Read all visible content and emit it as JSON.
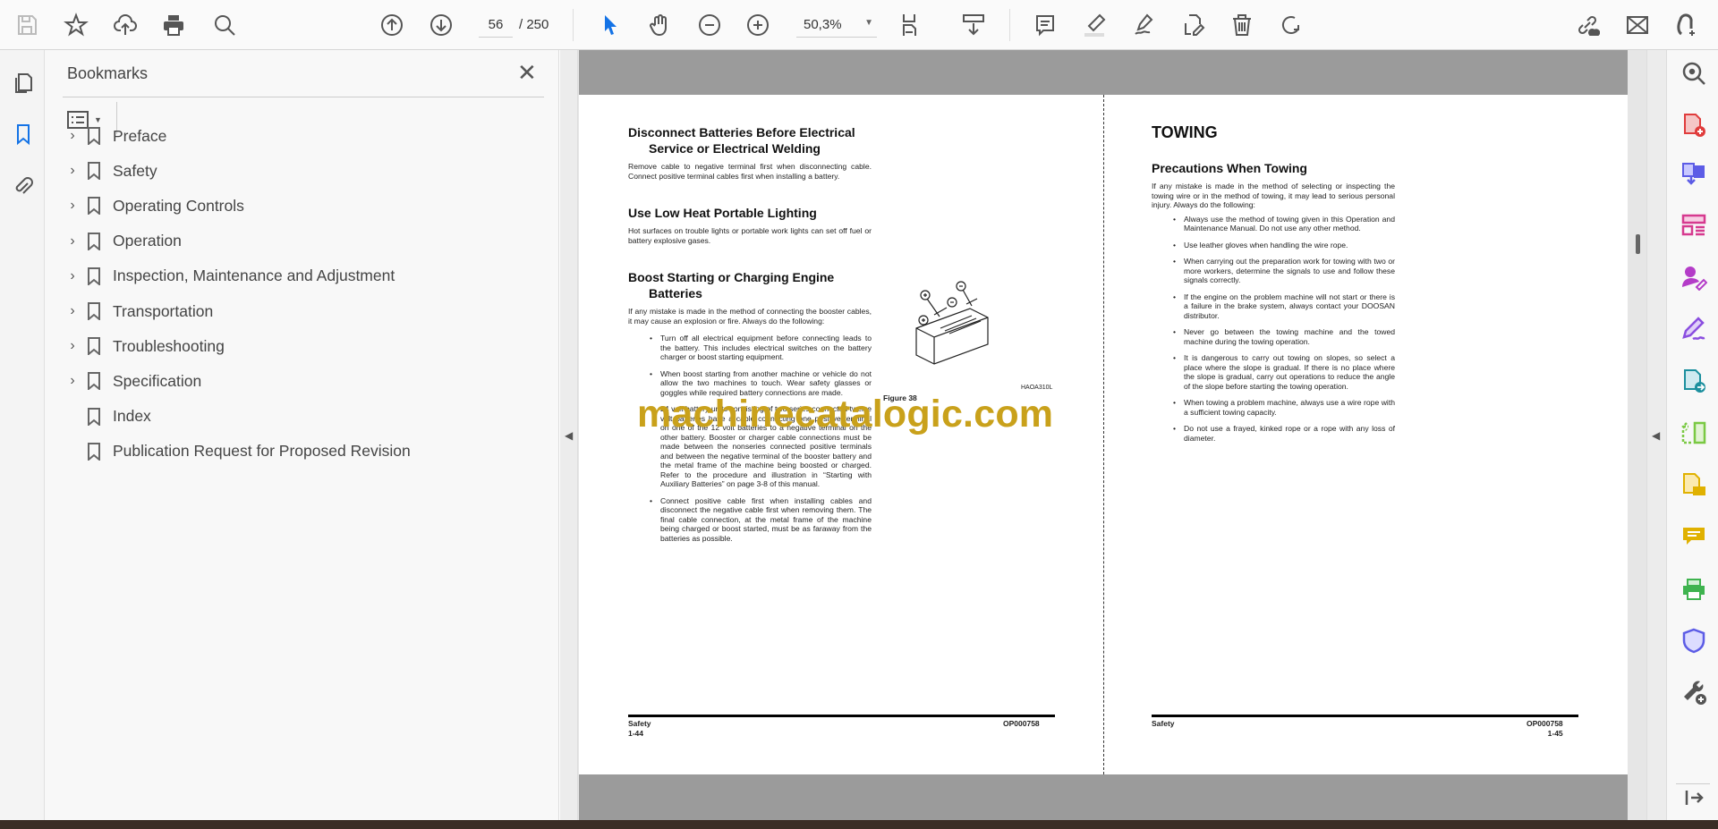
{
  "toolbar": {
    "page_current": "56",
    "page_total": "/ 250",
    "zoom": "50,3%",
    "tools": [
      "save-icon",
      "bookmark-star-icon",
      "upload-cloud-icon",
      "print-icon",
      "find-icon",
      "page-up-icon",
      "page-down-icon",
      "select-cursor-icon",
      "hand-icon",
      "zoom-out-icon",
      "zoom-in-icon",
      "fit-page-icon",
      "scroll-mode-icon",
      "comment-icon",
      "highlight-icon",
      "sign-icon",
      "edit-pdf-icon",
      "delete-icon",
      "rotate-icon",
      "share-link-icon",
      "email-icon",
      "add-user-icon"
    ]
  },
  "bookmarks": {
    "title": "Bookmarks",
    "items": [
      {
        "label": "Preface",
        "expandable": true
      },
      {
        "label": "Safety",
        "expandable": true
      },
      {
        "label": "Operating Controls",
        "expandable": true
      },
      {
        "label": "Operation",
        "expandable": true
      },
      {
        "label": "Inspection, Maintenance and Adjustment",
        "expandable": true
      },
      {
        "label": "Transportation",
        "expandable": true
      },
      {
        "label": "Troubleshooting",
        "expandable": true
      },
      {
        "label": "Specification",
        "expandable": true
      },
      {
        "label": "Index",
        "expandable": false
      },
      {
        "label": "Publication Request for Proposed Revision",
        "expandable": false
      }
    ]
  },
  "left_page": {
    "h1a": "Disconnect Batteries Before Electrical",
    "h1b": "Service or Electrical Welding",
    "p1": "Remove cable to negative terminal first when disconnecting cable. Connect positive terminal cables first when installing a battery.",
    "h2": "Use Low Heat Portable Lighting",
    "p2": "Hot surfaces on trouble lights or portable work lights can set off fuel or battery explosive gases.",
    "h3a": "Boost Starting or Charging Engine",
    "h3b": "Batteries",
    "p3": "If any mistake is made in the method of connecting the booster cables, it may cause an explosion or fire. Always do the following:",
    "bullets": [
      "Turn off all electrical equipment before connecting leads to the battery. This includes electrical switches on the battery charger or boost starting equipment.",
      "When boost starting from another machine or vehicle do not allow the two machines to touch. Wear safety glasses or goggles while required battery connections are made.",
      "24 volt battery units consisting of two series connected twelve volt batteries have a cable connecting one positive terminal on one of the 12 volt batteries to a negative terminal on the other battery. Booster or charger cable connections must be made between the nonseries connected positive terminals and between the negative terminal of the booster battery and the metal frame of the machine being boosted or charged. Refer to the procedure and illustration in “Starting with Auxiliary Batteries” on page 3-8 of this manual.",
      "Connect positive cable first when installing cables and disconnect the negative cable first when removing them. The final cable connection, at the metal frame of the machine being charged or boost started, must be as faraway from the batteries as possible."
    ],
    "figure_code": "HAOA310L",
    "figure_caption": "Figure 38",
    "footer_section": "Safety",
    "footer_page": "1-44",
    "footer_code": "OP000758"
  },
  "right_page": {
    "title": "TOWING",
    "h1": "Precautions When Towing",
    "p1": "If any mistake is made in the method of selecting or inspecting the towing wire or in the method of towing, it may lead to serious personal injury. Always do the following:",
    "bullets": [
      "Always use the method of towing given in this Operation and Maintenance Manual. Do not use any other method.",
      "Use leather gloves when handling the wire rope.",
      "When carrying out the preparation work for towing with two or more workers, determine the signals to use and follow these signals correctly.",
      "If the engine on the problem machine will not start or there is a failure in the brake system, always contact your DOOSAN distributor.",
      "Never go between the towing machine and the towed machine during the towing operation.",
      "It is dangerous to carry out towing on slopes, so select a place where the slope is gradual. If there is no place where the slope is gradual, carry out operations to reduce the angle of the slope before starting the towing operation.",
      "When towing a problem machine, always use a wire rope with a sufficient towing capacity.",
      "Do not use a frayed, kinked rope or a rope with any loss of diameter."
    ],
    "footer_section": "Safety",
    "footer_page": "1-45",
    "footer_code": "OP000758"
  },
  "watermark": "machinecatalogic.com",
  "bullet_char": "•",
  "colors": {
    "accent": "#1473e6",
    "watermark": "#c9a11b"
  }
}
